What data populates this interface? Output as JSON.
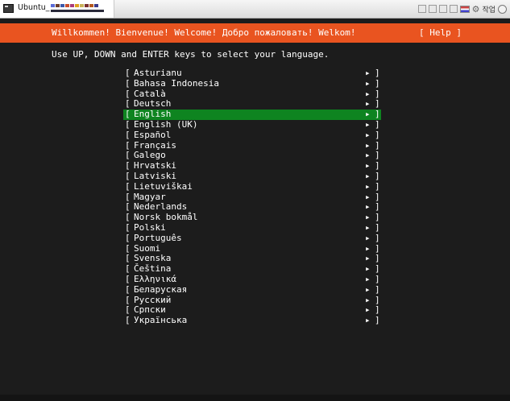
{
  "window": {
    "tab_title": "Ubuntu_",
    "toolbar_label": "작업",
    "redaction_colors": [
      "#5b6bd6",
      "#6a3c2a",
      "#3b58a8",
      "#c84d2b",
      "#aa3a7a",
      "#e0a020",
      "#c9b25a",
      "#7a2e2e",
      "#b4571c",
      "#3a3a8a"
    ]
  },
  "header": {
    "welcome": "Willkommen! Bienvenue! Welcome! Добро пожаловать! Welkom!",
    "help": "[ Help ]",
    "color": "#e95420"
  },
  "instruction": "Use UP, DOWN and ENTER keys to select your language.",
  "languages": {
    "open_bracket": "[",
    "close_bracket": "]",
    "arrow": "▸",
    "selected": "English",
    "selected_color": "#0e8420",
    "items": [
      "Asturianu",
      "Bahasa Indonesia",
      "Català",
      "Deutsch",
      "English",
      "English (UK)",
      "Español",
      "Français",
      "Galego",
      "Hrvatski",
      "Latviski",
      "Lietuviškai",
      "Magyar",
      "Nederlands",
      "Norsk bokmål",
      "Polski",
      "Português",
      "Suomi",
      "Svenska",
      "Čeština",
      "Ελληνικά",
      "Беларуская",
      "Русский",
      "Српски",
      "Українська"
    ]
  }
}
